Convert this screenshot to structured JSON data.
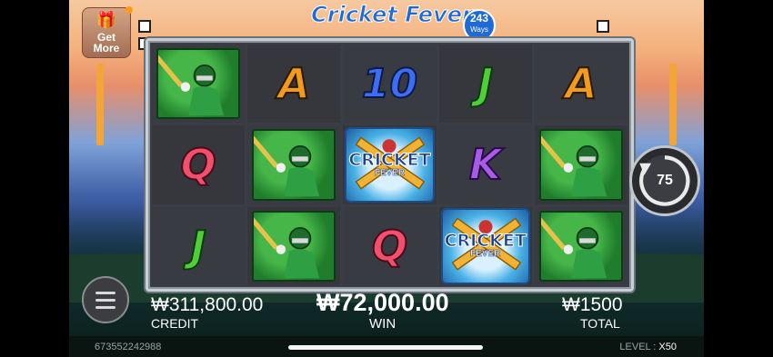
{
  "title": {
    "main": "Cricket Fever",
    "ways_number": "243",
    "ways_label": "Ways"
  },
  "get_more": {
    "line1": "Get",
    "line2": "More"
  },
  "reels": [
    [
      "player",
      "Q",
      "J"
    ],
    [
      "A",
      "player",
      "player"
    ],
    [
      "10",
      "scatter",
      "Q"
    ],
    [
      "J",
      "K",
      "scatter"
    ],
    [
      "A",
      "player",
      "player"
    ]
  ],
  "scatter": {
    "line1": "CRICKET",
    "line2": "FEVER"
  },
  "autospin": {
    "count": "75"
  },
  "stats": {
    "credit_value": "₩311,800.00",
    "credit_label": "CREDIT",
    "win_value": "₩72,000.00",
    "win_label": "WIN",
    "total_value": "₩1500",
    "total_label": "TOTAL"
  },
  "footer": {
    "id": "673552242988",
    "level_label": "LEVEL :",
    "level_value": "X50"
  },
  "colors": {
    "A": "#f29a1b",
    "10": "#3f6df2",
    "J": "#4fce3a",
    "Q": "#f0506c",
    "K": "#a75ce6"
  }
}
